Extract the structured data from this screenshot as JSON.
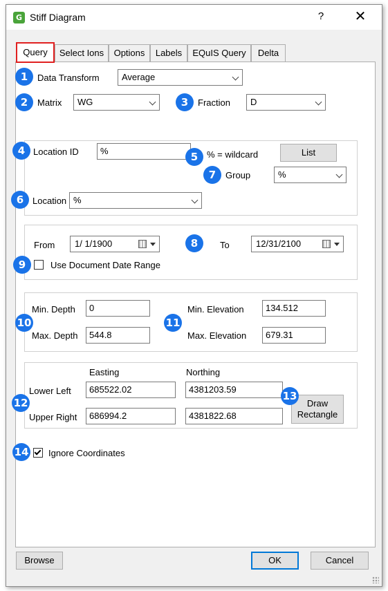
{
  "window": {
    "title": "Stiff Diagram",
    "help": "?",
    "close": "✕"
  },
  "tabs": [
    "Query",
    "Select Ions",
    "Options",
    "Labels",
    "EQuIS Query",
    "Delta"
  ],
  "badges": [
    "1",
    "2",
    "3",
    "4",
    "5",
    "6",
    "7",
    "8",
    "9",
    "10",
    "11",
    "12",
    "13",
    "14"
  ],
  "query": {
    "data_transform": {
      "label": "Data Transform",
      "value": "Average"
    },
    "matrix": {
      "label": "Matrix",
      "value": "WG"
    },
    "fraction": {
      "label": "Fraction",
      "value": "D"
    },
    "location_id": {
      "label": "Location ID",
      "value": "%"
    },
    "wildcard_note": "% = wildcard",
    "list_button": "List",
    "group": {
      "label": "Group",
      "value": "%"
    },
    "location": {
      "label": "Location",
      "value": "%"
    }
  },
  "dates": {
    "from_label": "From",
    "from_value": "1/ 1/1900",
    "to_label": "To",
    "to_value": "12/31/2100",
    "use_doc_range_label": "Use Document Date Range",
    "use_doc_range_checked": false
  },
  "depth_elev": {
    "min_depth_label": "Min. Depth",
    "min_depth": "0",
    "max_depth_label": "Max. Depth",
    "max_depth": "544.8",
    "min_elev_label": "Min. Elevation",
    "min_elev": "134.512",
    "max_elev_label": "Max. Elevation",
    "max_elev": "679.31"
  },
  "coords": {
    "easting_header": "Easting",
    "northing_header": "Northing",
    "lower_left_label": "Lower Left",
    "ll_easting": "685522.02",
    "ll_northing": "4381203.59",
    "upper_right_label": "Upper Right",
    "ur_easting": "686994.2",
    "ur_northing": "4381822.68",
    "draw_line1": "Draw",
    "draw_line2": "Rectangle"
  },
  "ignore_coords": {
    "label": "Ignore Coordinates",
    "checked": true
  },
  "footer": {
    "browse": "Browse",
    "ok": "OK",
    "cancel": "Cancel"
  },
  "colors": {
    "badge": "#1a73e8",
    "active_tab_border": "#e02020",
    "ok_border": "#0078d7"
  }
}
